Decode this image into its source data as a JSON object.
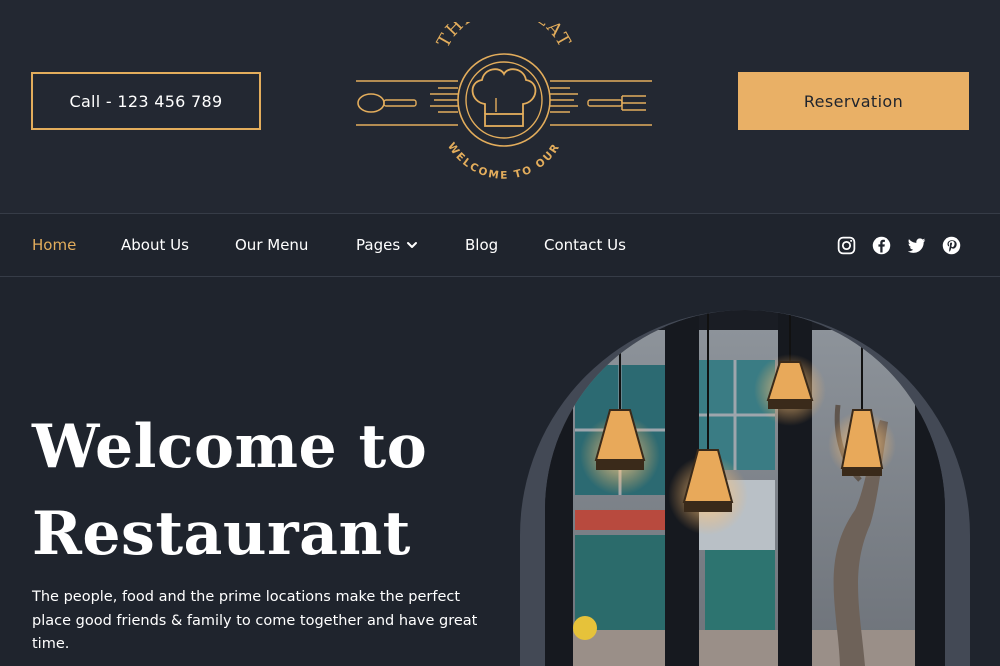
{
  "header": {
    "call_label": "Call - 123 456 789",
    "reservation_label": "Reservation",
    "logo": {
      "arc_text": "THE TASTEAT",
      "sub_text": "WELCOME TO OUR"
    }
  },
  "nav": {
    "items": [
      {
        "label": "Home",
        "active": true
      },
      {
        "label": "About Us"
      },
      {
        "label": "Our Menu"
      },
      {
        "label": "Pages",
        "dropdown": true
      },
      {
        "label": "Blog"
      },
      {
        "label": "Contact Us"
      }
    ],
    "socials": [
      "instagram-icon",
      "facebook-icon",
      "twitter-icon",
      "pinterest-icon"
    ]
  },
  "hero": {
    "title_line1": "Welcome to",
    "title_line2": "Restaurant",
    "description": "The people, food and the prime locations make the perfect place good friends & family to come together and have great time."
  },
  "colors": {
    "background": "#1f242d",
    "accent": "#e3ad5c",
    "button_fill": "#e9b066",
    "text": "#ffffff"
  }
}
